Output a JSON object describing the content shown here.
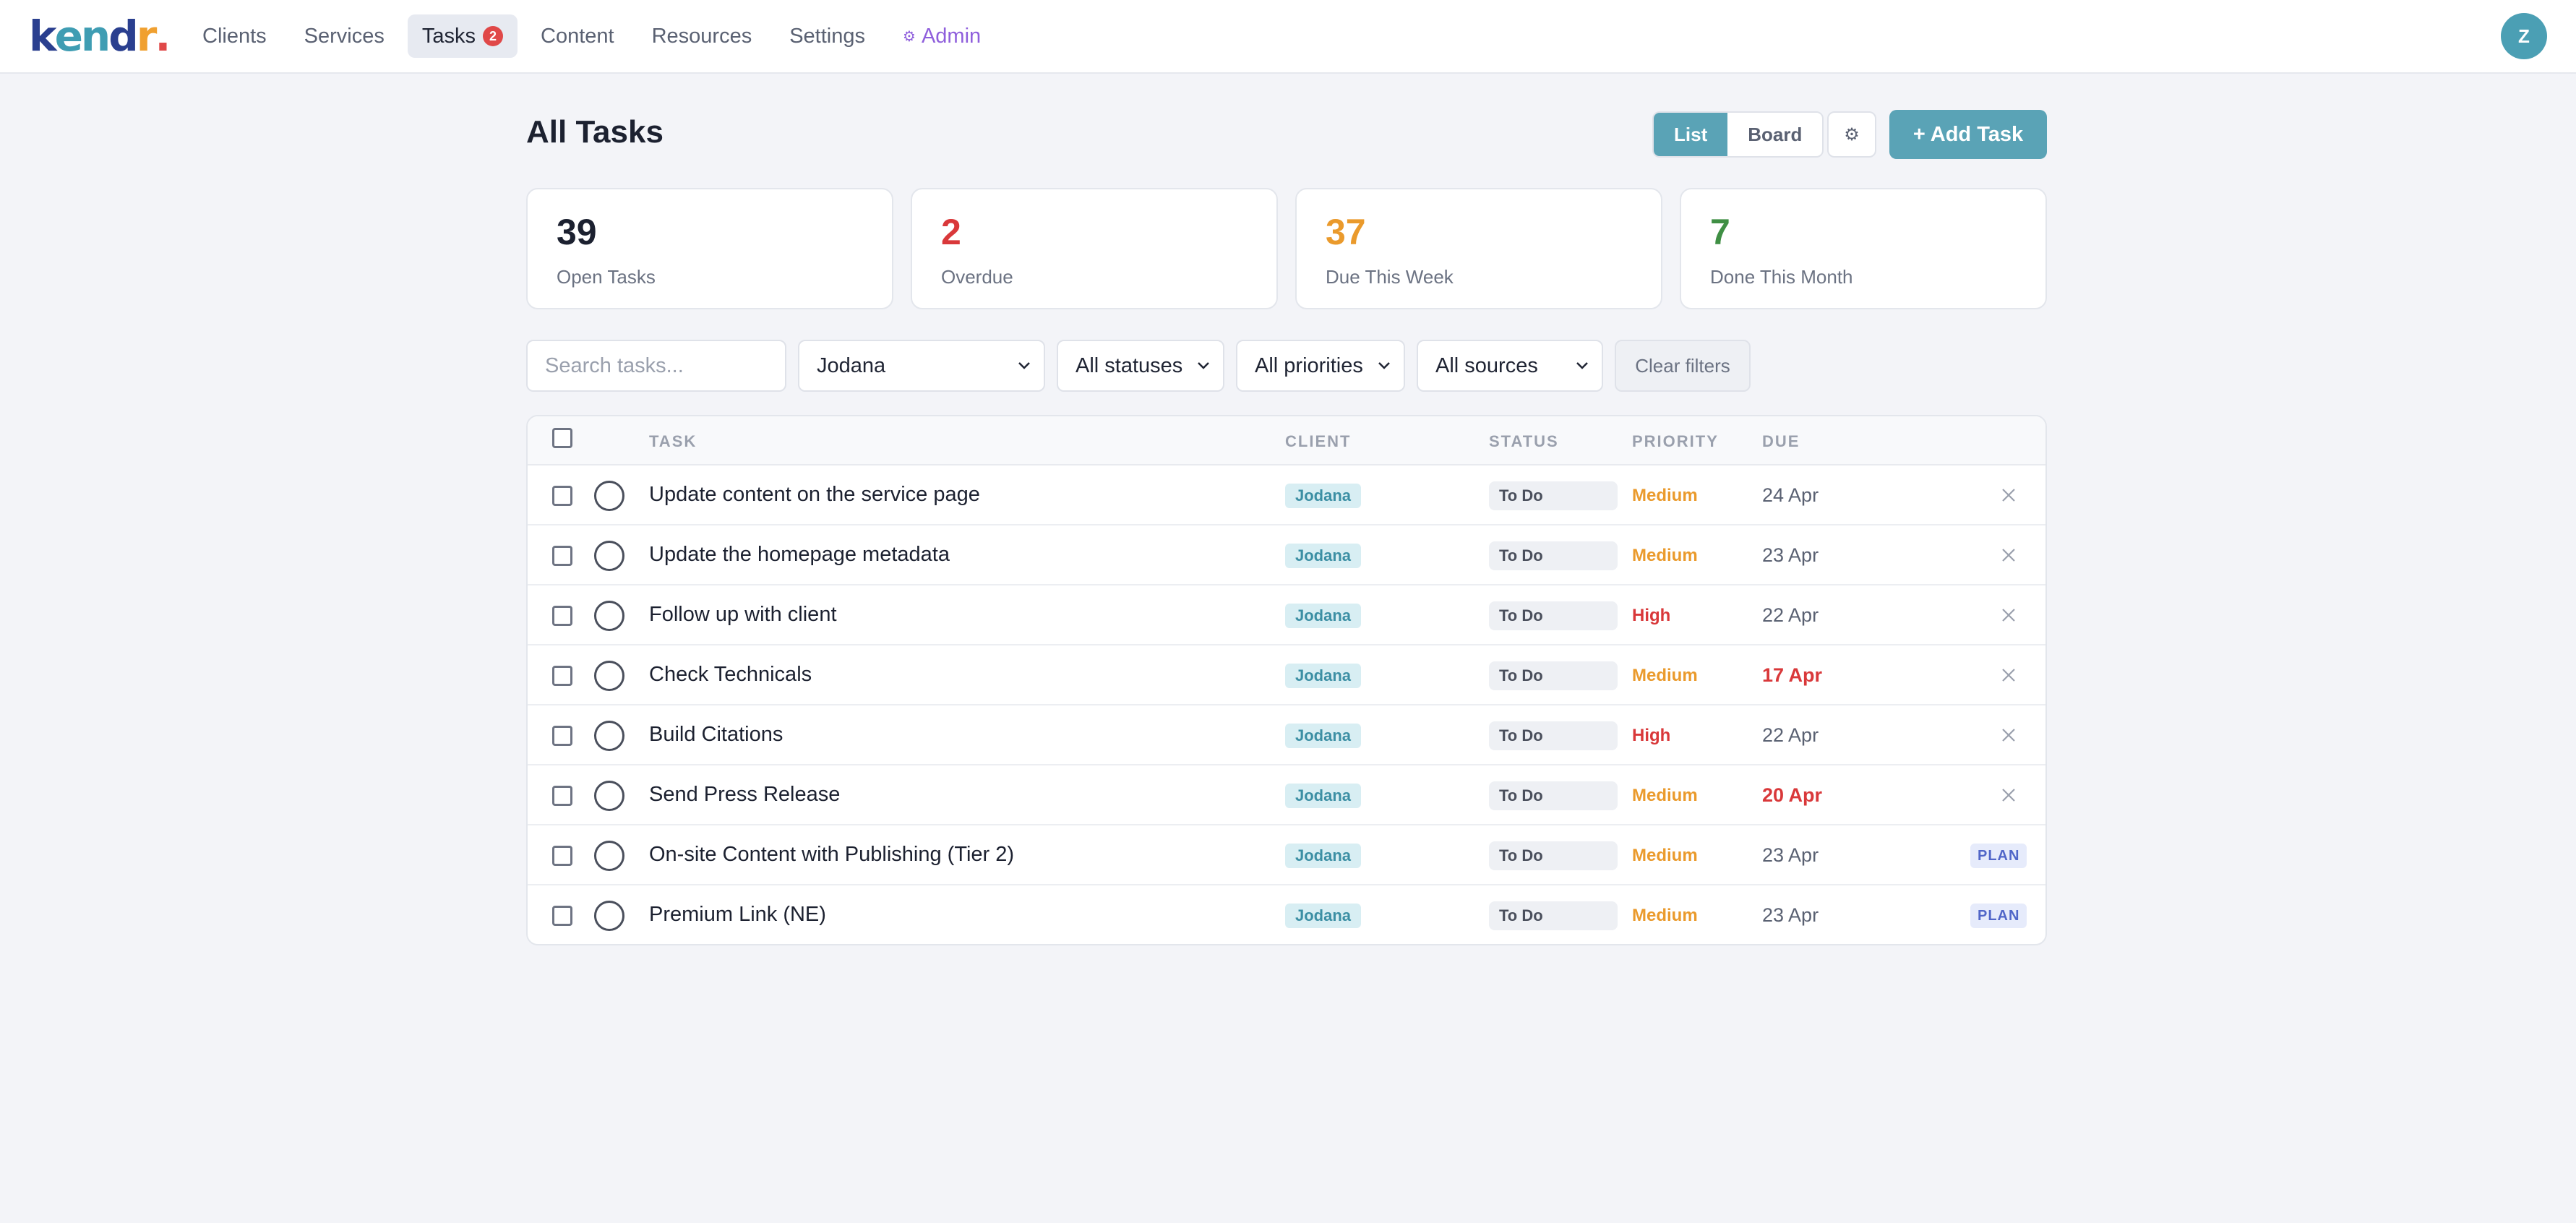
{
  "app": {
    "logo": {
      "letters": [
        "k",
        "e",
        "n",
        "d",
        "r",
        "."
      ],
      "colors": [
        "#2a3f8f",
        "#3f9db3",
        "#3f9db3",
        "#2a3f8f",
        "#f0a030",
        "#e04848"
      ]
    },
    "avatar_initial": "Z"
  },
  "nav": {
    "items": [
      {
        "label": "Clients"
      },
      {
        "label": "Services"
      },
      {
        "label": "Tasks",
        "badge": "2",
        "active": true
      },
      {
        "label": "Content"
      },
      {
        "label": "Resources"
      },
      {
        "label": "Settings"
      },
      {
        "label": "Admin",
        "icon": "settings-icon"
      }
    ]
  },
  "header": {
    "title": "All Tasks",
    "view_list": "List",
    "view_board": "Board",
    "add_task": "+ Add Task"
  },
  "stats": [
    {
      "value": "39",
      "label": "Open Tasks",
      "color": "#1c2130"
    },
    {
      "value": "2",
      "label": "Overdue",
      "color": "#d9383a"
    },
    {
      "value": "37",
      "label": "Due This Week",
      "color": "#ea9a2c"
    },
    {
      "value": "7",
      "label": "Done This Month",
      "color": "#3f8f44"
    }
  ],
  "filters": {
    "search_placeholder": "Search tasks...",
    "client": "Jodana",
    "status": "All statuses",
    "priority": "All priorities",
    "source": "All sources",
    "clear": "Clear filters"
  },
  "table": {
    "columns": {
      "task": "TASK",
      "client": "CLIENT",
      "status": "STATUS",
      "priority": "PRIORITY",
      "due": "DUE"
    },
    "rows": [
      {
        "task": "Update content on the service page",
        "client": "Jodana",
        "status": "To Do",
        "priority": "Medium",
        "due": "24 Apr",
        "overdue": false,
        "action": "delete"
      },
      {
        "task": "Update the homepage metadata",
        "client": "Jodana",
        "status": "To Do",
        "priority": "Medium",
        "due": "23 Apr",
        "overdue": false,
        "action": "delete"
      },
      {
        "task": "Follow up with client",
        "client": "Jodana",
        "status": "To Do",
        "priority": "High",
        "due": "22 Apr",
        "overdue": false,
        "action": "delete"
      },
      {
        "task": "Check Technicals",
        "client": "Jodana",
        "status": "To Do",
        "priority": "Medium",
        "due": "17 Apr",
        "overdue": true,
        "action": "delete"
      },
      {
        "task": "Build Citations",
        "client": "Jodana",
        "status": "To Do",
        "priority": "High",
        "due": "22 Apr",
        "overdue": false,
        "action": "delete"
      },
      {
        "task": "Send Press Release",
        "client": "Jodana",
        "status": "To Do",
        "priority": "Medium",
        "due": "20 Apr",
        "overdue": true,
        "action": "delete"
      },
      {
        "task": "On-site Content with Publishing (Tier 2)",
        "client": "Jodana",
        "status": "To Do",
        "priority": "Medium",
        "due": "23 Apr",
        "overdue": false,
        "action": "PLAN"
      },
      {
        "task": "Premium Link (NE)",
        "client": "Jodana",
        "status": "To Do",
        "priority": "Medium",
        "due": "23 Apr",
        "overdue": false,
        "action": "PLAN"
      }
    ]
  },
  "colors": {
    "accent": "#5aa3b6",
    "priority_medium": "#ea9a2c",
    "priority_high": "#d9383a",
    "admin": "#8f5fdc"
  }
}
